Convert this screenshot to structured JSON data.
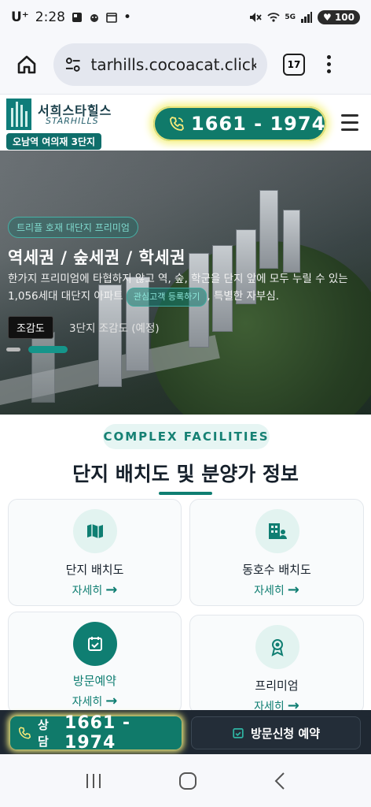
{
  "statusbar": {
    "carrier": "U⁺",
    "time": "2:28",
    "dot": "•",
    "network": "5G",
    "battery": "100"
  },
  "browser": {
    "url": "tarhills.cocoacat.click",
    "tabs": "17"
  },
  "header": {
    "logo_ko": "서희스타힐스",
    "logo_en": "STARHILLS",
    "logo_badge": "오남역 여의재 3단지",
    "phone": "1661 - 1974"
  },
  "hero": {
    "tag": "트리플 호재 대단지 프리미엄",
    "title": "역세권 / 숲세권 / 학세권",
    "desc_before": "한가지 프리미엄에 타협하지 않고 역, 숲, 학군을 단지 앞에 모두 누릴 수 있는 1,056세대 대단지 아파트",
    "desc_chip": "관심고객 등록하기",
    "desc_after": ", 특별한 자부심.",
    "view_button": "조감도",
    "view_caption": "3단지 조감도 (예정)"
  },
  "section": {
    "badge": "COMPLEX FACILITIES",
    "title": "단지 배치도 및 분양가 정보"
  },
  "cards": [
    {
      "title": "단지 배치도",
      "link": "자세히",
      "icon": "map-icon"
    },
    {
      "title": "동호수 배치도",
      "link": "자세히",
      "icon": "building-person-icon"
    },
    {
      "title": "방문예약",
      "link": "자세히",
      "icon": "calendar-check-icon"
    },
    {
      "title": "프리미엄",
      "link": "자세히",
      "icon": "award-icon"
    }
  ],
  "bottom_bar": {
    "consult_label": "상담",
    "consult_number": "1661 - 1974",
    "visit_label": "방문신청 예약"
  },
  "colors": {
    "brand": "#0f7e72",
    "glow": "#f1ee81",
    "dark_bar": "#1f2832"
  }
}
